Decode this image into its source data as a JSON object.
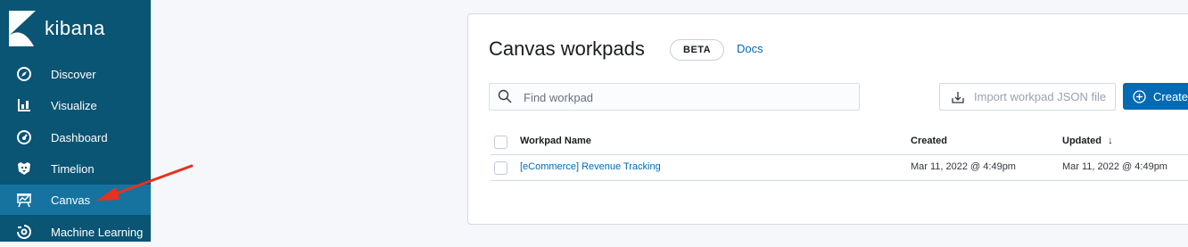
{
  "brand": {
    "name": "kibana"
  },
  "nav": [
    {
      "label": "Discover",
      "icon": "compass-icon",
      "active": false
    },
    {
      "label": "Visualize",
      "icon": "bar-chart-icon",
      "active": false
    },
    {
      "label": "Dashboard",
      "icon": "dashboard-icon",
      "active": false
    },
    {
      "label": "Timelion",
      "icon": "timelion-icon",
      "active": false
    },
    {
      "label": "Canvas",
      "icon": "canvas-icon",
      "active": true
    },
    {
      "label": "Machine Learning",
      "icon": "machine-learning-icon",
      "active": false
    }
  ],
  "page": {
    "title": "Canvas workpads",
    "beta": "BETA",
    "docs": "Docs"
  },
  "search": {
    "placeholder": "Find workpad",
    "value": ""
  },
  "buttons": {
    "import": "Import workpad JSON file",
    "create": "Create"
  },
  "table": {
    "headers": {
      "name": "Workpad Name",
      "created": "Created",
      "updated": "Updated"
    },
    "sort_indicator": "↓",
    "rows": [
      {
        "name": "[eCommerce] Revenue Tracking",
        "created": "Mar 11, 2022 @ 4:49pm",
        "updated": "Mar 11, 2022 @ 4:49pm"
      }
    ]
  },
  "colors": {
    "sidebar": "#0a5474",
    "sidebar_active": "#1673a0",
    "accent": "#006bb4",
    "annotation_arrow": "#e8311a"
  }
}
